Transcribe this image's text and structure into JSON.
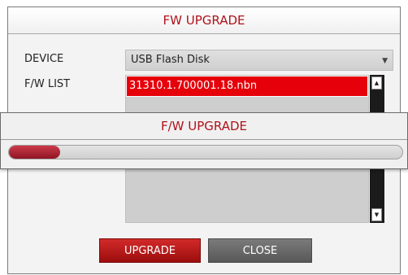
{
  "dialog": {
    "title": "FW UPGRADE",
    "device_label": "DEVICE",
    "device_value": "USB Flash Disk",
    "fw_list_label": "F/W LIST",
    "fw_files": [
      "31310.1.700001.18.nbn"
    ],
    "upgrade_button": "UPGRADE",
    "close_button": "CLOSE"
  },
  "progress": {
    "title": "F/W UPGRADE",
    "fraction": 0.13
  },
  "colors": {
    "accent": "#b0121b",
    "selection": "#e6000a",
    "progress_fill": "#a3182a"
  }
}
